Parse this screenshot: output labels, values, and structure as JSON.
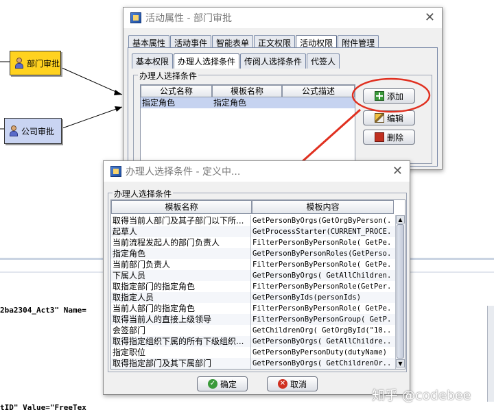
{
  "canvas": {
    "node1": "部门审批",
    "node2": "公司审批",
    "code_line1": "2ba2304_Act3\" Name=",
    "code_line2": "tID\" Value=\"FreeTex"
  },
  "dialog1": {
    "title": "活动属性 - 部门审批",
    "tabs": [
      "基本属性",
      "活动事件",
      "智能表单",
      "正文权限",
      "活动权限",
      "附件管理"
    ],
    "subtabs": [
      "基本权限",
      "办理人选择条件",
      "传阅人选择条件",
      "代签人"
    ],
    "group_label": "办理人选择条件",
    "columns": [
      "公式名称",
      "模板名称",
      "公式描述"
    ],
    "rows": [
      [
        "指定角色",
        "指定角色",
        ""
      ]
    ],
    "buttons": {
      "add": "添加",
      "edit": "编辑",
      "delete": "删除"
    }
  },
  "dialog2": {
    "title": "办理人选择条件 - 定义中...",
    "group_label": "办理人选择条件",
    "columns": [
      "模板名称",
      "模板内容"
    ],
    "rows": [
      [
        "取得当前人部门及其子部门以下所...",
        "GetPersonByOrgs(GetOrgByPerson(..."
      ],
      [
        "起草人",
        "GetProcessStarter(CURRENT_PROCE..."
      ],
      [
        "当前流程发起人的部门负责人",
        "FilterPersonByPersonRole( GetPe..."
      ],
      [
        "指定角色",
        "GetPersonByPersonRoles(GetPerso..."
      ],
      [
        "当前部门负责人",
        "FilterPersonByPersonRole( GetPe..."
      ],
      [
        "下属人员",
        "GetPersonByOrgs( GetAllChildren..."
      ],
      [
        "取指定部门的指定角色",
        "FilterPersonByPersonRole(GetPer..."
      ],
      [
        "取指定人员",
        "GetPersonByIds(personIds)"
      ],
      [
        "当前人部门的指定角色",
        "FilterPersonByPersonRole( GetPe..."
      ],
      [
        "取得当前人的直接上级领导",
        "FilterPersonByPersonGroup( GetP..."
      ],
      [
        "会签部门",
        "GetChildrenOrg(  GetOrgById(\"10..."
      ],
      [
        "取得指定组织下属的所有下级组织...",
        "GetPersonByOrgs(  GetAllChildre..."
      ],
      [
        "指定职位",
        "GetPersonByPersonDuty(dutyName)"
      ],
      [
        "取得指定部门及其下属部门",
        "GetPersonByOrgs(  GetChildrenOr..."
      ]
    ],
    "buttons": {
      "ok": "确定",
      "cancel": "取消"
    }
  },
  "watermark": "知乎 @codebee",
  "colors": {
    "node_fill": "#ffd21f",
    "node2_fill": "#c9d4f2",
    "annotation_red": "#e03020"
  }
}
